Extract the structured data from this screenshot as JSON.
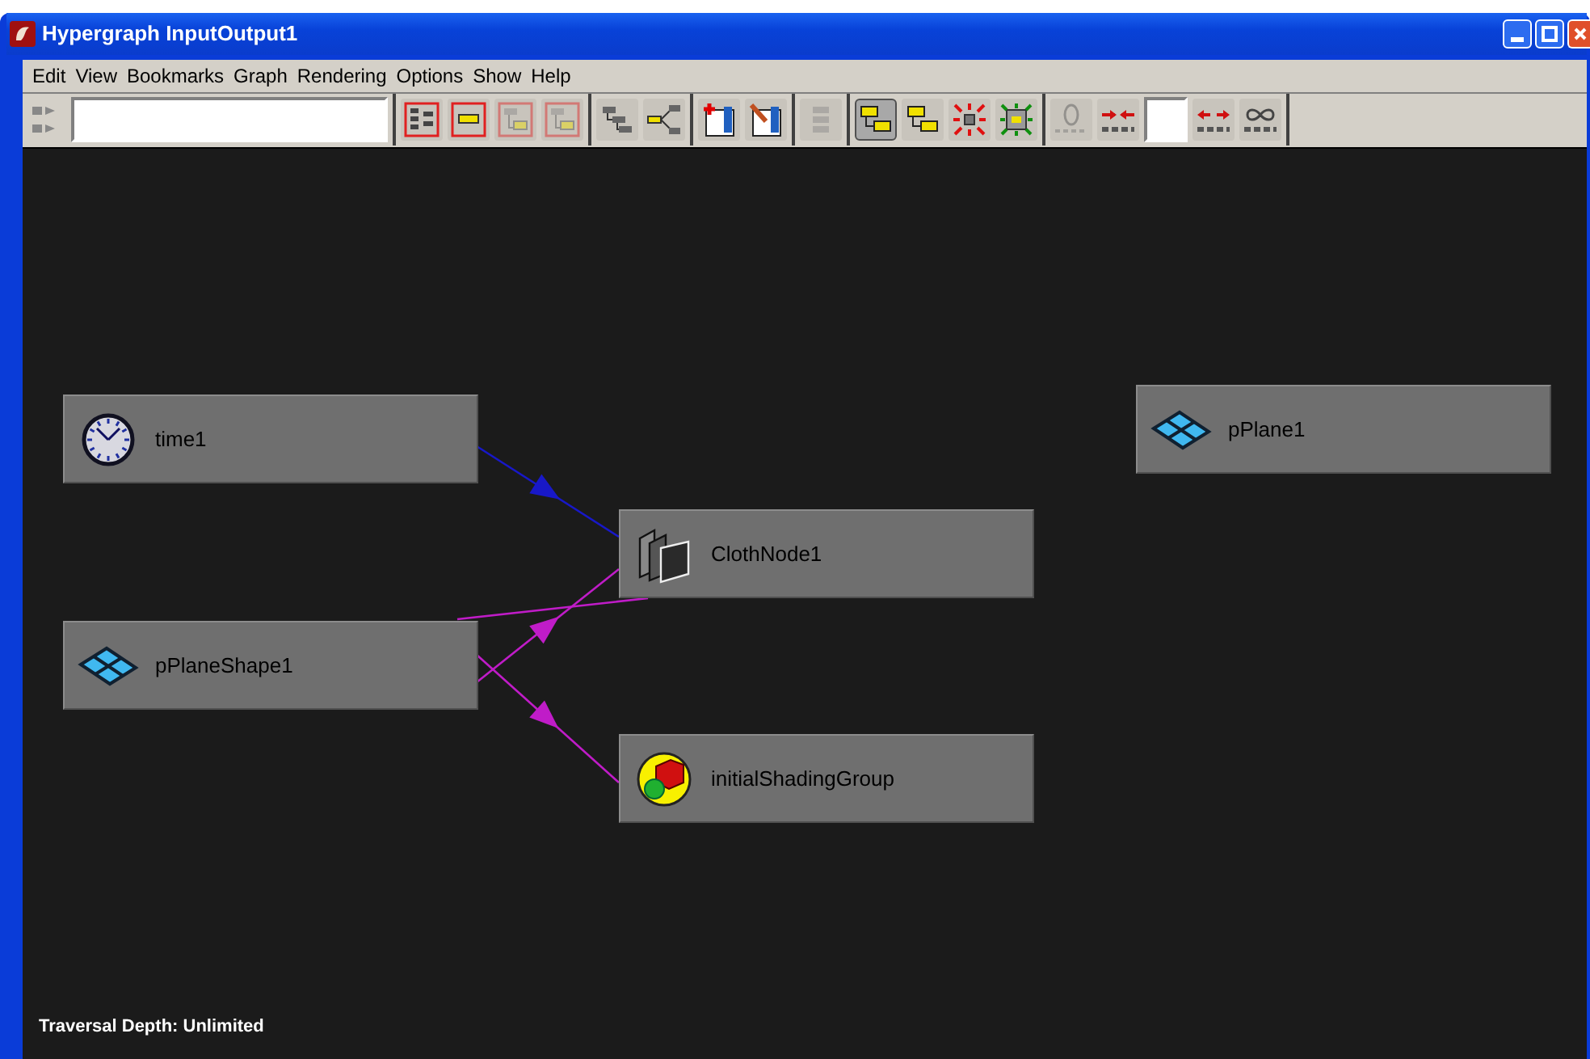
{
  "window": {
    "title": "Hypergraph InputOutput1"
  },
  "menu": [
    "Edit",
    "View",
    "Bookmarks",
    "Graph",
    "Rendering",
    "Options",
    "Show",
    "Help"
  ],
  "toolbar": [
    [
      {
        "kind": "grip"
      },
      {
        "kind": "field"
      }
    ],
    [
      {
        "kind": "scene-hierarchy",
        "disabled": false,
        "pressed": false
      },
      {
        "kind": "single-node",
        "disabled": false,
        "pressed": false
      },
      {
        "kind": "tree-node",
        "disabled": true,
        "pressed": false
      },
      {
        "kind": "framed-tree",
        "disabled": true,
        "pressed": false
      }
    ],
    [
      {
        "kind": "hierarchy",
        "disabled": false,
        "pressed": false
      },
      {
        "kind": "branch",
        "disabled": false,
        "pressed": false
      }
    ],
    [
      {
        "kind": "add-bookmark",
        "disabled": false,
        "pressed": false
      },
      {
        "kind": "edit-bookmark",
        "disabled": false,
        "pressed": false
      }
    ],
    [
      {
        "kind": "list",
        "disabled": true,
        "pressed": false
      }
    ],
    [
      {
        "kind": "layout",
        "disabled": false,
        "pressed": true
      },
      {
        "kind": "layout",
        "disabled": false,
        "pressed": false
      },
      {
        "kind": "shrink",
        "disabled": false,
        "pressed": false
      },
      {
        "kind": "expand",
        "disabled": false,
        "pressed": false
      }
    ],
    [
      {
        "kind": "zero-depth",
        "disabled": true,
        "pressed": false
      },
      {
        "kind": "depth-in",
        "disabled": false,
        "pressed": false
      },
      {
        "kind": "field"
      },
      {
        "kind": "depth-out",
        "disabled": false,
        "pressed": false
      },
      {
        "kind": "infinite-depth",
        "disabled": false,
        "pressed": false
      }
    ]
  ],
  "nodes": [
    {
      "label": "time1",
      "kind": "clock"
    },
    {
      "label": "pPlaneShape1",
      "kind": "plane"
    },
    {
      "label": "ClothNode1",
      "kind": "cloth"
    },
    {
      "label": "initialShadingGroup",
      "kind": "shading"
    },
    {
      "label": "pPlane1",
      "kind": "plane"
    }
  ],
  "connections": [
    {
      "color": "#1818c8"
    },
    {
      "color": "#c01cc8"
    },
    {
      "color": "#c01cc8"
    },
    {
      "color": "#c01cc8"
    }
  ],
  "status": "Traversal Depth: Unlimited"
}
